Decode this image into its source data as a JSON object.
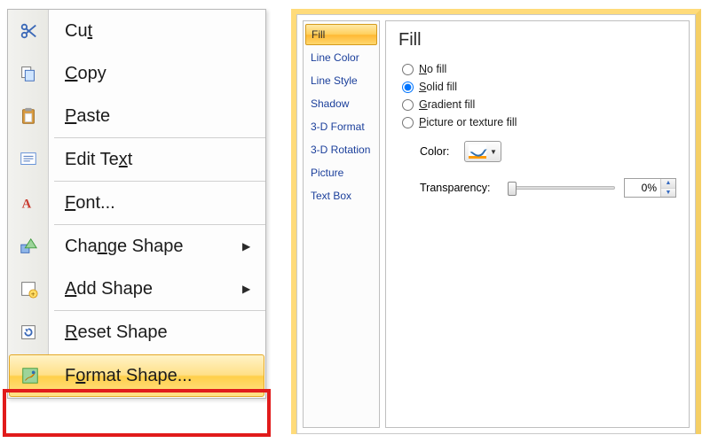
{
  "context_menu": {
    "items": [
      {
        "id": "cut",
        "label": "Cut",
        "accel_index": 2,
        "icon": "scissors-icon",
        "has_submenu": false
      },
      {
        "id": "copy",
        "label": "Copy",
        "accel_index": 0,
        "icon": "copy-icon",
        "has_submenu": false
      },
      {
        "id": "paste",
        "label": "Paste",
        "accel_index": 0,
        "icon": "paste-icon",
        "has_submenu": false
      },
      {
        "id": "edit-text",
        "label": "Edit Text",
        "accel_index": 7,
        "icon": "edit-text-icon",
        "has_submenu": false
      },
      {
        "id": "font",
        "label": "Font...",
        "accel_index": 0,
        "icon": "font-icon",
        "has_submenu": false
      },
      {
        "id": "change-shape",
        "label": "Change Shape",
        "accel_index": 3,
        "icon": "change-shape-icon",
        "has_submenu": true
      },
      {
        "id": "add-shape",
        "label": "Add Shape",
        "accel_index": 0,
        "icon": "add-shape-icon",
        "has_submenu": true
      },
      {
        "id": "reset-shape",
        "label": "Reset Shape",
        "accel_index": 0,
        "icon": "reset-shape-icon",
        "has_submenu": false
      },
      {
        "id": "format-shape",
        "label": "Format Shape...",
        "accel_index": 1,
        "icon": "format-shape-icon",
        "has_submenu": false,
        "highlight": true
      }
    ],
    "separators_after": [
      2,
      3,
      4,
      6
    ]
  },
  "dialog": {
    "categories": [
      "Fill",
      "Line Color",
      "Line Style",
      "Shadow",
      "3-D Format",
      "3-D Rotation",
      "Picture",
      "Text Box"
    ],
    "selected_category": "Fill",
    "fill_panel": {
      "title": "Fill",
      "options": [
        {
          "id": "no-fill",
          "label": "No fill",
          "accel_index": 0,
          "selected": false
        },
        {
          "id": "solid-fill",
          "label": "Solid fill",
          "accel_index": 0,
          "selected": true
        },
        {
          "id": "gradient-fill",
          "label": "Gradient fill",
          "accel_index": 0,
          "selected": false
        },
        {
          "id": "picture-fill",
          "label": "Picture or texture fill",
          "accel_index": 0,
          "selected": false
        }
      ],
      "color_label": "Color:",
      "transparency_label": "Transparency:",
      "transparency_value": "0%"
    }
  }
}
